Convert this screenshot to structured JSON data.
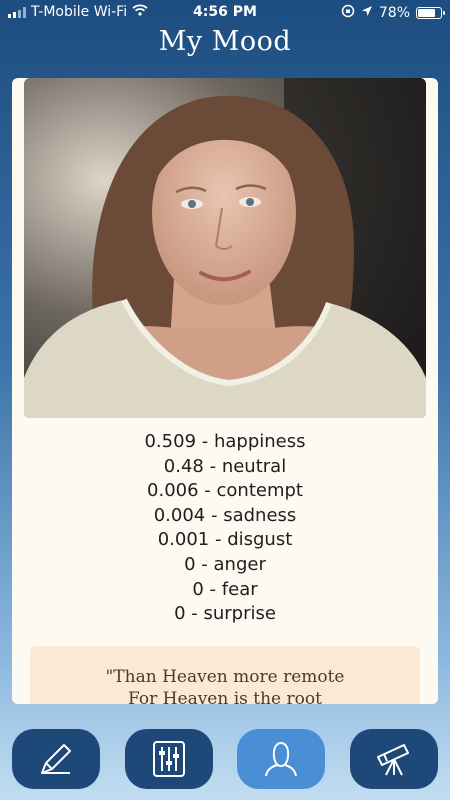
{
  "status_bar": {
    "carrier": "T-Mobile Wi-Fi",
    "time": "4:56 PM",
    "battery": "78%"
  },
  "header": {
    "title": "My Mood"
  },
  "emotions": [
    {
      "score": "0.509",
      "label": "happiness"
    },
    {
      "score": "0.48",
      "label": "neutral"
    },
    {
      "score": "0.006",
      "label": "contempt"
    },
    {
      "score": "0.004",
      "label": "sadness"
    },
    {
      "score": "0.001",
      "label": "disgust"
    },
    {
      "score": "0",
      "label": "anger"
    },
    {
      "score": "0",
      "label": "fear"
    },
    {
      "score": "0",
      "label": "surprise"
    }
  ],
  "quote": {
    "line1": "\"Than Heaven more remote",
    "line2": "For Heaven is the root"
  },
  "tabbar": {
    "items": [
      {
        "icon": "pencil-icon"
      },
      {
        "icon": "sliders-icon"
      },
      {
        "icon": "person-icon",
        "active": true
      },
      {
        "icon": "telescope-icon"
      }
    ]
  },
  "colors": {
    "accent": "#4a8fd6",
    "nav_button": "#1e4877",
    "card": "#fdfaf2",
    "quote_bg": "#fbe9d4"
  }
}
